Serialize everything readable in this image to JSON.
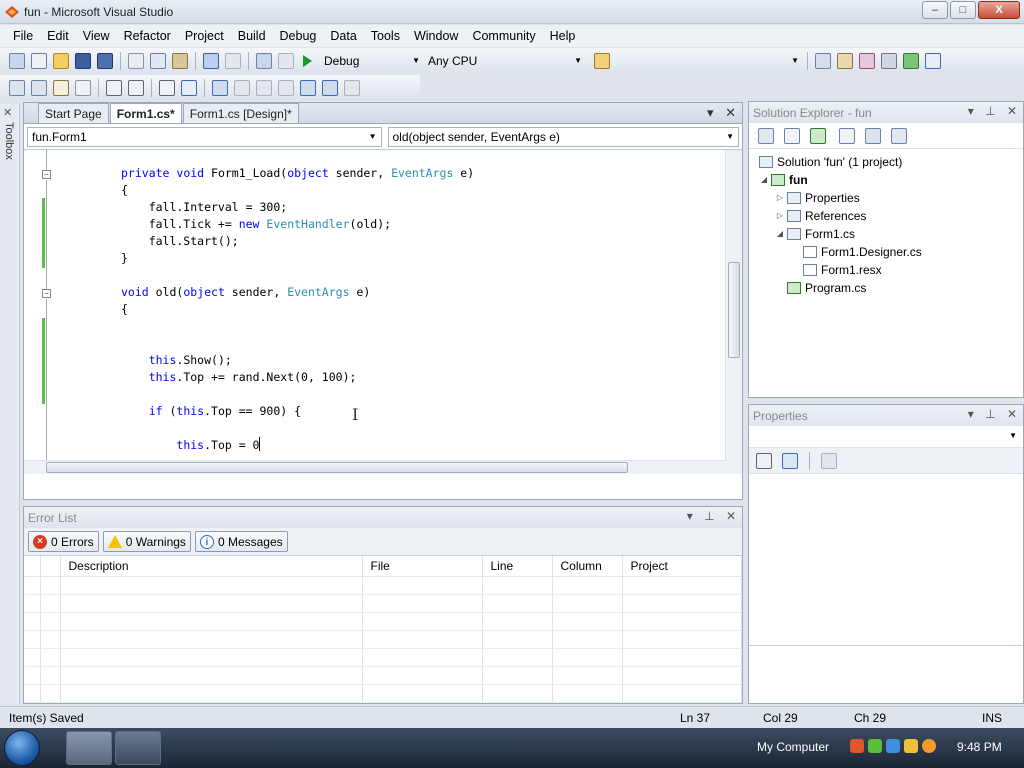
{
  "window": {
    "title": "fun - Microsoft Visual Studio",
    "minimize": "–",
    "maximize": "□",
    "close": "X"
  },
  "menu": [
    "File",
    "Edit",
    "View",
    "Refactor",
    "Project",
    "Build",
    "Debug",
    "Data",
    "Tools",
    "Window",
    "Community",
    "Help"
  ],
  "toolbar": {
    "config": "Debug",
    "platform": "Any CPU"
  },
  "toolbox_label": "Toolbox",
  "doc_tabs": [
    "Start Page",
    "Form1.cs*",
    "Form1.cs [Design]*"
  ],
  "nav": {
    "type": "fun.Form1",
    "member": "old(object sender, EventArgs e)"
  },
  "code_lines": [
    "private void Form1_Load(object sender, EventArgs e)",
    "{",
    "    fall.Interval = 300;",
    "    fall.Tick += new EventHandler(old);",
    "    fall.Start();",
    "}",
    "",
    "void old(object sender, EventArgs e)",
    "{",
    "",
    "",
    "    this.Show();",
    "    this.Top += rand.Next(0, 100);",
    "",
    "    if (this.Top == 900) {",
    "",
    "        this.Top = 0",
    "",
    "    }"
  ],
  "error_list": {
    "title": "Error List",
    "errors": "0 Errors",
    "warnings": "0 Warnings",
    "messages": "0 Messages",
    "columns": [
      "",
      "",
      "Description",
      "File",
      "Line",
      "Column",
      "Project"
    ]
  },
  "solution_explorer": {
    "title": "Solution Explorer - fun",
    "solution": "Solution 'fun' (1 project)",
    "project": "fun",
    "items": [
      "Properties",
      "References",
      "Form1.cs",
      "Form1.Designer.cs",
      "Form1.resx",
      "Program.cs"
    ]
  },
  "properties": {
    "title": "Properties"
  },
  "status": {
    "message": "Item(s) Saved",
    "line": "Ln 37",
    "col": "Col 29",
    "ch": "Ch 29",
    "mode": "INS"
  },
  "taskbar": {
    "location": "My Computer",
    "time": "9:48 PM"
  }
}
